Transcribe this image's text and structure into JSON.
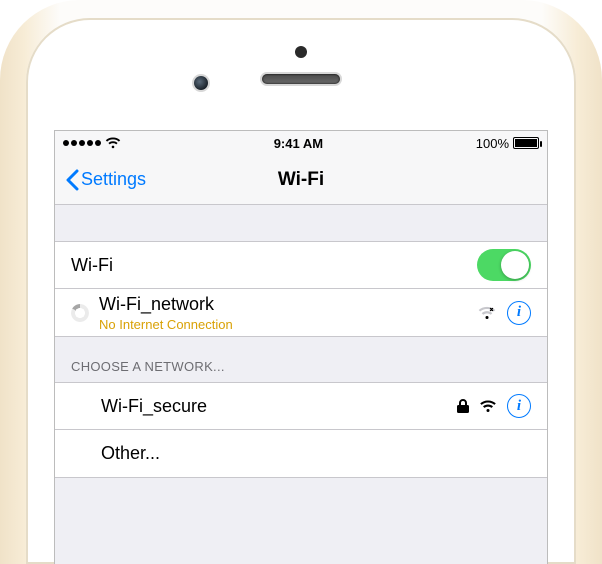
{
  "statusbar": {
    "time": "9:41 AM",
    "battery_pct": "100%"
  },
  "navbar": {
    "back_label": "Settings",
    "title": "Wi-Fi"
  },
  "wifi_toggle": {
    "label": "Wi-Fi",
    "on": true
  },
  "current_network": {
    "name": "Wi-Fi_network",
    "status": "No Internet Connection"
  },
  "choose_header": "CHOOSE A NETWORK...",
  "networks": [
    {
      "name": "Wi-Fi_secure",
      "secured": true
    }
  ],
  "other_label": "Other..."
}
